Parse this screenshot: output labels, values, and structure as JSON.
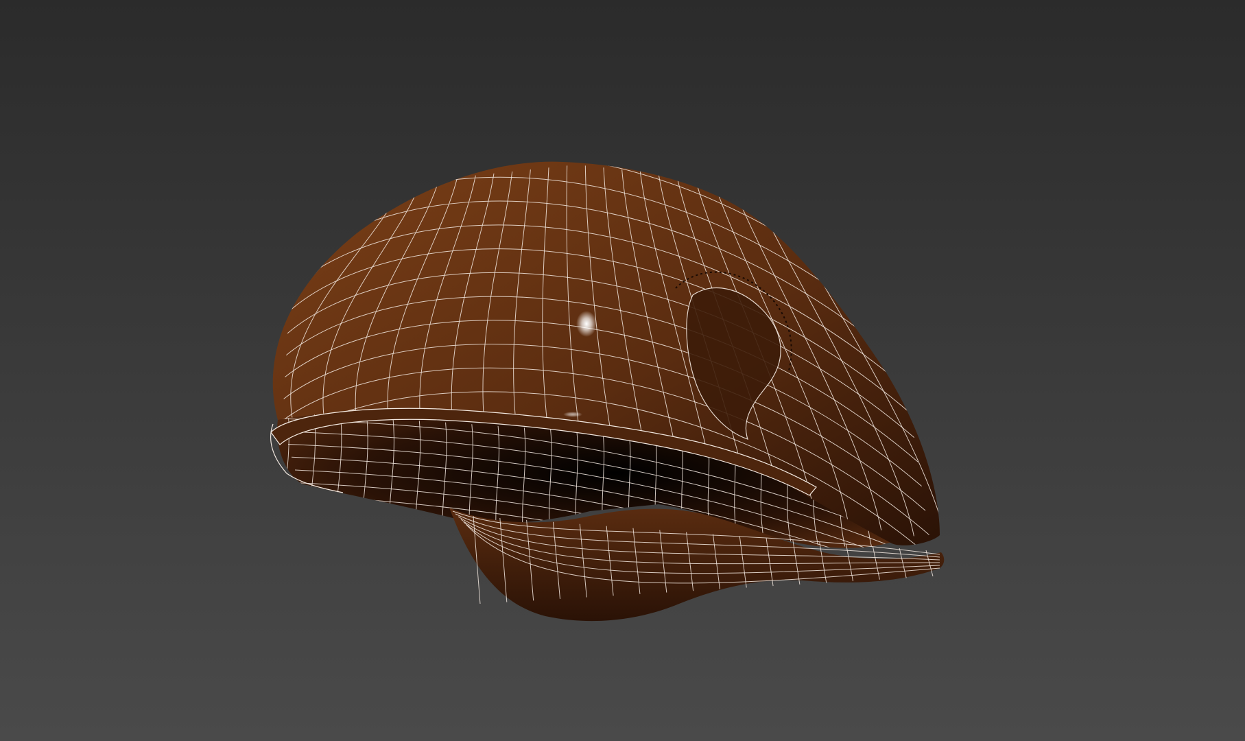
{
  "viewport": {
    "background_top": "#2b2b2b",
    "background_bottom": "#4a4a4a",
    "shading_mode": "shaded-with-wireframe"
  },
  "model": {
    "object": "flat-cap",
    "material_color_light": "#7a3f17",
    "material_color_mid": "#5a2c10",
    "material_color_dark": "#2a1206",
    "wire_color": "#f3e9e1",
    "highlight_color": "#ffffff"
  }
}
